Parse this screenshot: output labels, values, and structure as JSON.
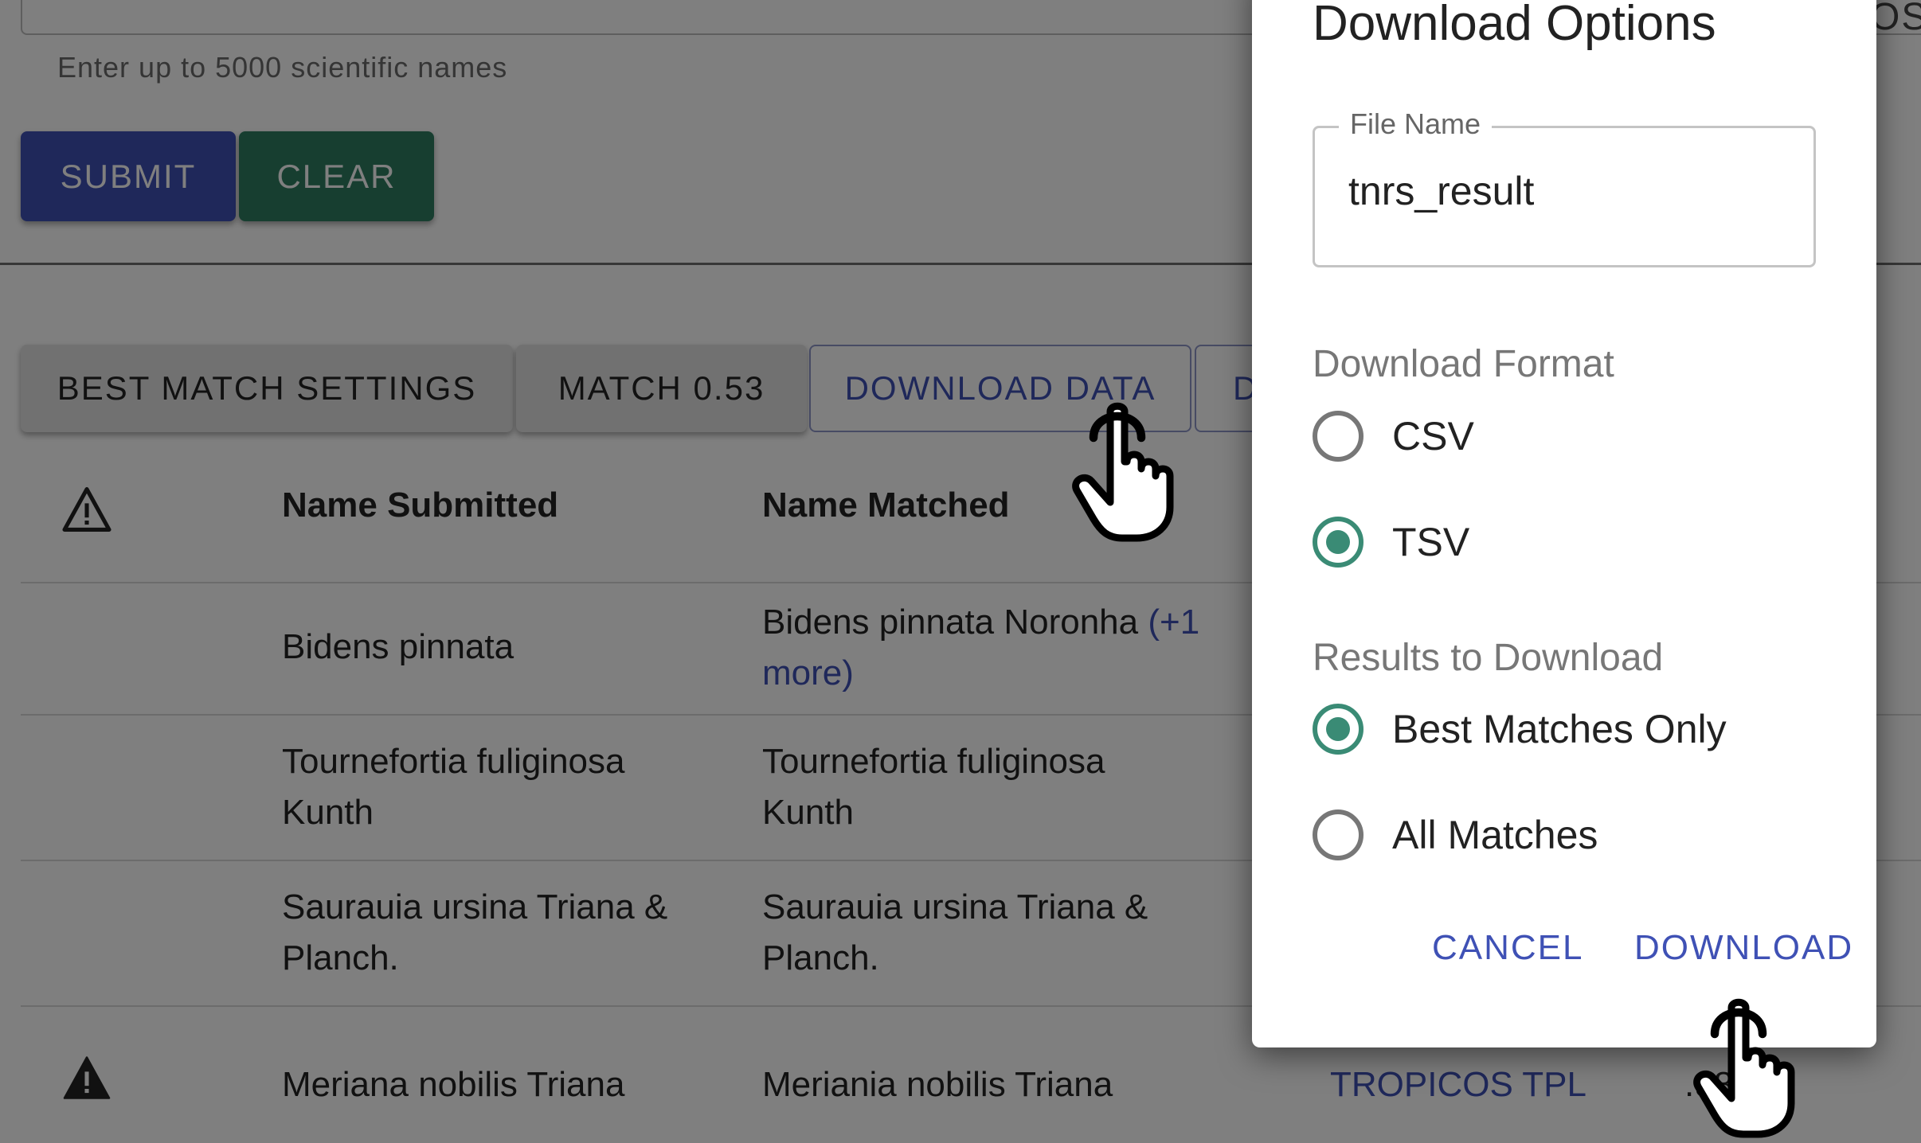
{
  "form": {
    "helper_text": "Enter up to 5000 scientific names",
    "submit_label": "SUBMIT",
    "clear_label": "CLEAR"
  },
  "toolbar": {
    "best_match_settings_label": "BEST MATCH SETTINGS",
    "match_label": "MATCH 0.53",
    "download_data_label": "DOWNLOAD DATA",
    "partial_button_label": "D"
  },
  "table": {
    "columns": [
      "Name Submitted",
      "Name Matched"
    ],
    "rows": [
      {
        "warning": false,
        "submitted": "Bidens pinnata",
        "matched": "Bidens pinnata Noronha",
        "more": "(+1 more)"
      },
      {
        "warning": false,
        "submitted": "Tournefortia fuliginosa Kunth",
        "matched": "Tournefortia fuliginosa Kunth"
      },
      {
        "warning": false,
        "submitted": "Saurauia ursina Triana & Planch.",
        "matched": "Saurauia ursina Triana & Planch."
      },
      {
        "warning": true,
        "submitted": "Meriana nobilis Triana",
        "matched": "Meriania nobilis Triana",
        "source": "TROPICOS TPL",
        "score": ".98"
      }
    ]
  },
  "overlay_partial_text": "OS",
  "dialog": {
    "title": "Download Options",
    "file_name_label": "File Name",
    "file_name_value": "tnrs_result",
    "format_label": "Download Format",
    "format_options": [
      {
        "label": "CSV",
        "selected": false
      },
      {
        "label": "TSV",
        "selected": true
      }
    ],
    "results_label": "Results to Download",
    "results_options": [
      {
        "label": "Best Matches Only",
        "selected": true
      },
      {
        "label": "All Matches",
        "selected": false
      }
    ],
    "cancel_label": "CANCEL",
    "download_label": "DOWNLOAD"
  },
  "colors": {
    "primary": "#3f51b5",
    "submit": "#3f51b5",
    "clear": "#2e7d60",
    "radio_selected": "#3a8b75",
    "backdrop": "rgba(0,0,0,0.5)"
  }
}
